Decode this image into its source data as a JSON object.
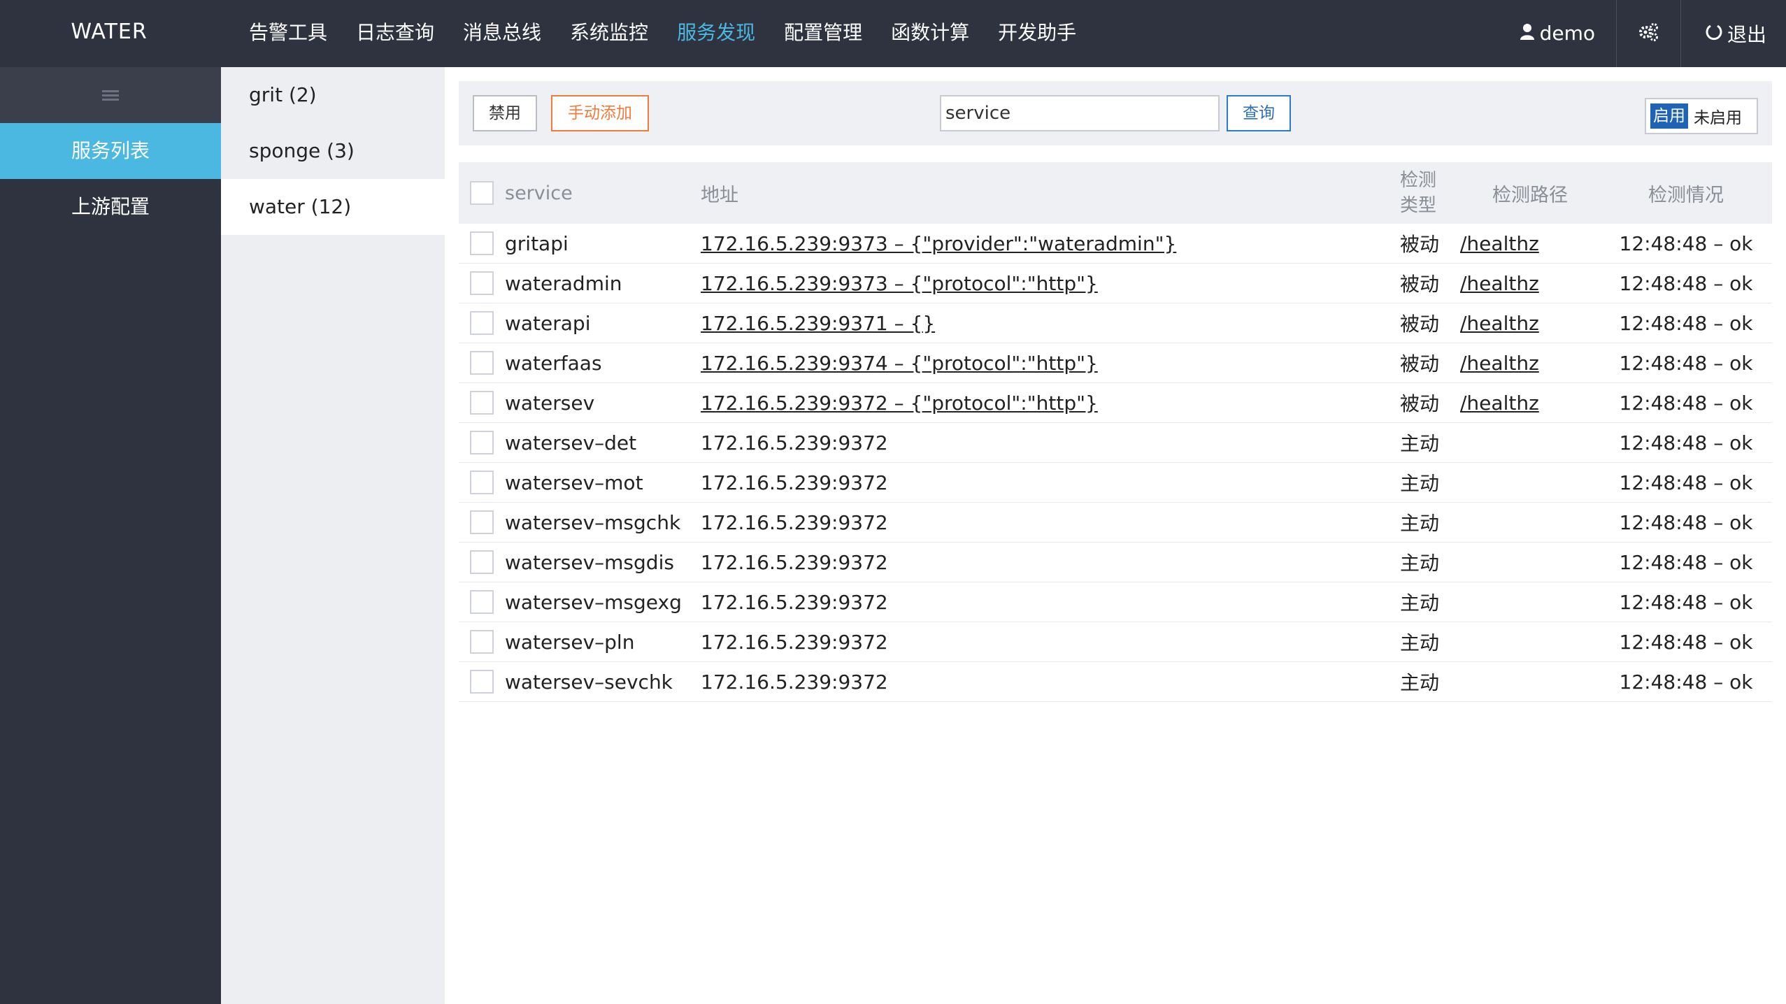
{
  "header": {
    "brand": "WATER",
    "nav": [
      "告警工具",
      "日志查询",
      "消息总线",
      "系统监控",
      "服务发现",
      "配置管理",
      "函数计算",
      "开发助手"
    ],
    "active_nav": "服务发现",
    "user": "demo",
    "logout": "退出",
    "accent_color": "#4ab8e0"
  },
  "sidebar": {
    "items": [
      "服务列表",
      "上游配置"
    ],
    "active": "服务列表"
  },
  "groups": {
    "items": [
      "grit (2)",
      "sponge (3)",
      "water (12)"
    ],
    "active": "water (12)"
  },
  "toolbar": {
    "disable_label": "禁用",
    "add_label": "手动添加",
    "search_value": "service",
    "query_label": "查询",
    "toggle_on": "启用",
    "toggle_off": "未启用"
  },
  "table": {
    "headers": {
      "service": "service",
      "address": "地址",
      "check_type": "检测类型",
      "check_path": "检测路径",
      "check_status": "检测情况"
    },
    "rows": [
      {
        "service": "gritapi",
        "address": "172.16.5.239:9373 – {\"provider\":\"wateradmin\"}",
        "type": "被动",
        "path": "/healthz",
        "status": "12:48:48 – ok"
      },
      {
        "service": "wateradmin",
        "address": "172.16.5.239:9373 – {\"protocol\":\"http\"}",
        "type": "被动",
        "path": "/healthz",
        "status": "12:48:48 – ok"
      },
      {
        "service": "waterapi",
        "address": "172.16.5.239:9371 – {}",
        "type": "被动",
        "path": "/healthz",
        "status": "12:48:48 – ok"
      },
      {
        "service": "waterfaas",
        "address": "172.16.5.239:9374 – {\"protocol\":\"http\"}",
        "type": "被动",
        "path": "/healthz",
        "status": "12:48:48 – ok"
      },
      {
        "service": "watersev",
        "address": "172.16.5.239:9372 – {\"protocol\":\"http\"}",
        "type": "被动",
        "path": "/healthz",
        "status": "12:48:48 – ok"
      },
      {
        "service": "watersev–det",
        "address": "172.16.5.239:9372",
        "type": "主动",
        "path": "",
        "status": "12:48:48 – ok"
      },
      {
        "service": "watersev–mot",
        "address": "172.16.5.239:9372",
        "type": "主动",
        "path": "",
        "status": "12:48:48 – ok"
      },
      {
        "service": "watersev–msgchk",
        "address": "172.16.5.239:9372",
        "type": "主动",
        "path": "",
        "status": "12:48:48 – ok"
      },
      {
        "service": "watersev–msgdis",
        "address": "172.16.5.239:9372",
        "type": "主动",
        "path": "",
        "status": "12:48:48 – ok"
      },
      {
        "service": "watersev–msgexg",
        "address": "172.16.5.239:9372",
        "type": "主动",
        "path": "",
        "status": "12:48:48 – ok"
      },
      {
        "service": "watersev–pln",
        "address": "172.16.5.239:9372",
        "type": "主动",
        "path": "",
        "status": "12:48:48 – ok"
      },
      {
        "service": "watersev–sevchk",
        "address": "172.16.5.239:9372",
        "type": "主动",
        "path": "",
        "status": "12:48:48 – ok"
      }
    ]
  }
}
